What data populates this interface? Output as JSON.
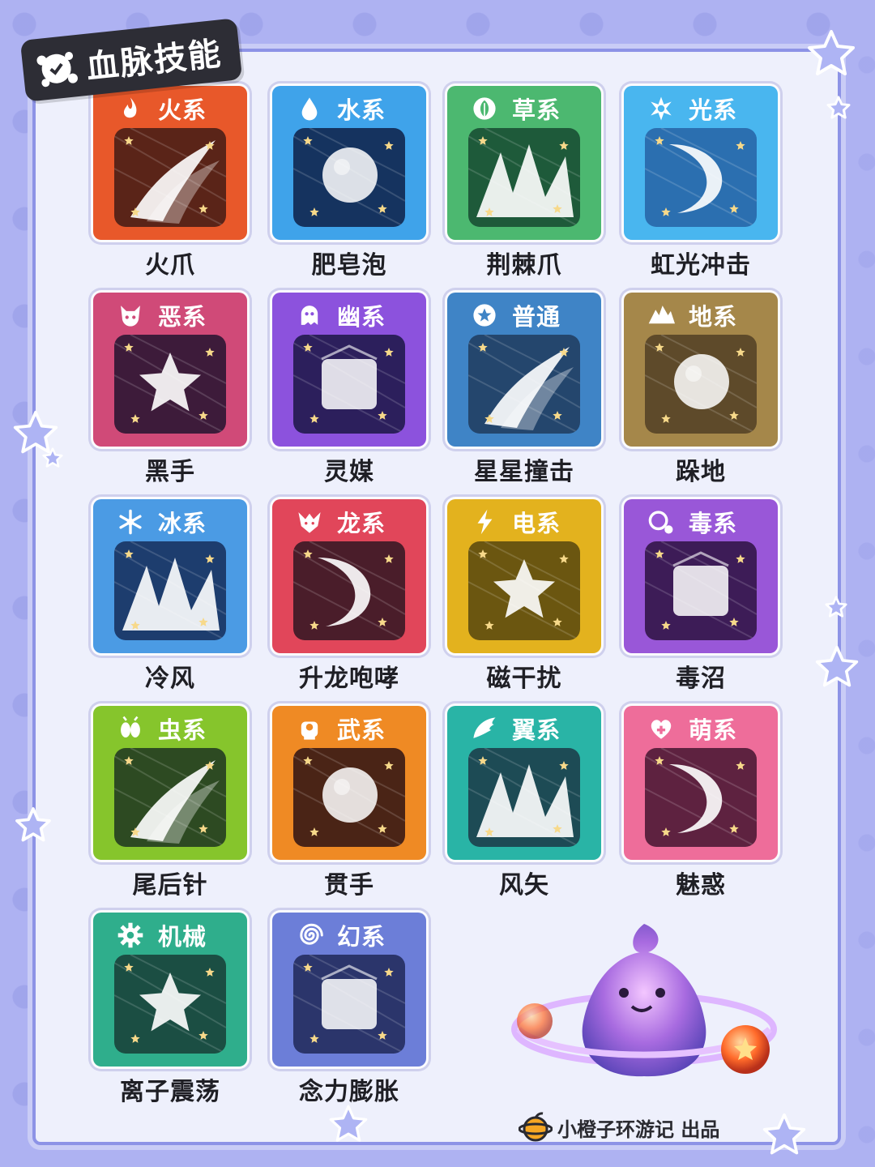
{
  "title": "血脉技能",
  "footer": {
    "text": "小橙子环游记 出品"
  },
  "cards": [
    {
      "type": "火系",
      "skill": "火爪",
      "icon": "flame-icon",
      "color": "#e8582a",
      "art": "#5a2418"
    },
    {
      "type": "水系",
      "skill": "肥皂泡",
      "icon": "water-drop-icon",
      "color": "#3fa3ea",
      "art": "#15335f"
    },
    {
      "type": "草系",
      "skill": "荆棘爪",
      "icon": "leaf-icon",
      "color": "#4cb870",
      "art": "#1e5a3a"
    },
    {
      "type": "光系",
      "skill": "虹光冲击",
      "icon": "sparkle-icon",
      "color": "#49b6ef",
      "art": "#2b6fb0"
    },
    {
      "type": "恶系",
      "skill": "黑手",
      "icon": "devil-icon",
      "color": "#d04a78",
      "art": "#3d1b3a"
    },
    {
      "type": "幽系",
      "skill": "灵媒",
      "icon": "ghost-icon",
      "color": "#8c52dd",
      "art": "#2c1f5c"
    },
    {
      "type": "普通",
      "skill": "星星撞击",
      "icon": "flower-icon",
      "color": "#3f84c6",
      "art": "#24466d"
    },
    {
      "type": "地系",
      "skill": "跺地",
      "icon": "mountain-icon",
      "color": "#a5874a",
      "art": "#5e4a2a"
    },
    {
      "type": "冰系",
      "skill": "冷风",
      "icon": "snowflake-icon",
      "color": "#4b9be4",
      "art": "#1d3d6e"
    },
    {
      "type": "龙系",
      "skill": "升龙咆哮",
      "icon": "dragon-icon",
      "color": "#e1465a",
      "art": "#4a1d2a"
    },
    {
      "type": "电系",
      "skill": "磁干扰",
      "icon": "lightning-icon",
      "color": "#e3b21e",
      "art": "#6b5610"
    },
    {
      "type": "毒系",
      "skill": "毒沼",
      "icon": "poison-bubble-icon",
      "color": "#9957d8",
      "art": "#3d1c57"
    },
    {
      "type": "虫系",
      "skill": "尾后针",
      "icon": "bug-icon",
      "color": "#86c52c",
      "art": "#2d4a22"
    },
    {
      "type": "武系",
      "skill": "贯手",
      "icon": "fist-icon",
      "color": "#ef8a24",
      "art": "#4a2416"
    },
    {
      "type": "翼系",
      "skill": "风矢",
      "icon": "wing-icon",
      "color": "#29b4a6",
      "art": "#1d4b55"
    },
    {
      "type": "萌系",
      "skill": "魅惑",
      "icon": "heart-icon",
      "color": "#ee6d9a",
      "art": "#5e2240"
    },
    {
      "type": "机械",
      "skill": "离子震荡",
      "icon": "gear-icon",
      "color": "#2fae8c",
      "art": "#1b4e43"
    },
    {
      "type": "幻系",
      "skill": "念力膨胀",
      "icon": "swirl-icon",
      "color": "#6c7ed8",
      "art": "#2b356b"
    }
  ]
}
